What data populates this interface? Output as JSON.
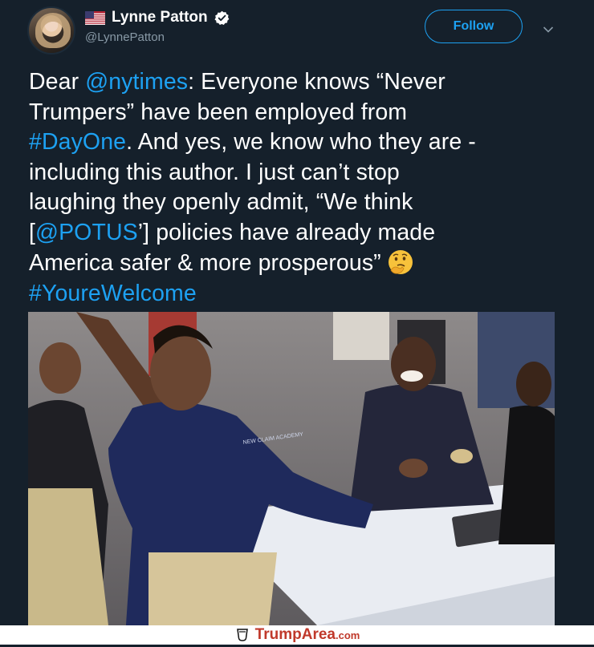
{
  "user": {
    "display_name": "Lynne Patton",
    "handle": "@LynnePatton",
    "avatar_icon": "profile-photo",
    "flag_icon": "us-flag-icon",
    "verified_icon": "verified-badge-icon"
  },
  "header": {
    "follow_label": "Follow",
    "menu_icon": "chevron-down-icon"
  },
  "tweet": {
    "l1_a": "Dear ",
    "l1_link": "@nytimes",
    "l1_b": ":  Everyone knows “Never",
    "l2": "Trumpers” have been employed from",
    "l3_link": "#DayOne",
    "l3_b": ".  And yes, we know who they are -",
    "l4": "including this author.  I just can’t stop",
    "l5": "laughing they openly admit, “We think",
    "l6_a": "[",
    "l6_link": "@POTUS",
    "l6_b": "’] policies have already made",
    "l7": "America safer & more prosperous”",
    "l7_emoji": "thinking-face-emoji",
    "l8_link": "#YoureWelcome"
  },
  "media": {
    "description_icon": "video-thumbnail",
    "shirt_text": "NEW CLAIM ACADEMY"
  },
  "watermark": {
    "logo_icon": "cup-icon",
    "brand": "TrumpArea",
    "domain": ".com"
  },
  "colors": {
    "background": "#15202b",
    "link": "#1da1f2",
    "text": "#ffffff",
    "muted": "#8899a6",
    "brand": "#c0392b"
  }
}
